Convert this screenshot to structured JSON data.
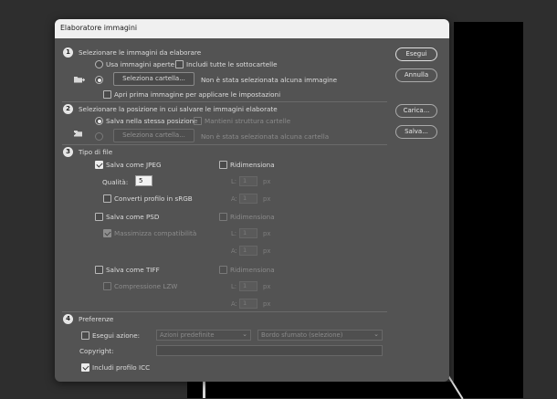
{
  "dialog": {
    "title": "Elaboratore immagini",
    "buttons": {
      "run": "Esegui",
      "cancel": "Annulla",
      "load": "Carica...",
      "save": "Salva..."
    }
  },
  "section1": {
    "step": "1",
    "title": "Selezionare le immagini da elaborare",
    "use_open": "Usa immagini aperte",
    "include_sub": "Includi tutte le sottocartelle",
    "select_folder": "Seleziona cartella...",
    "none_selected": "Non è stata selezionata alcuna immagine",
    "open_first": "Apri prima immagine per applicare le impostazioni"
  },
  "section2": {
    "step": "2",
    "title": "Selezionare la posizione in cui salvare le immagini elaborate",
    "same_location": "Salva nella stessa posizione",
    "keep_structure": "Mantieni struttura cartelle",
    "select_folder": "Seleziona cartella...",
    "none_selected": "Non è stata selezionata alcuna cartella"
  },
  "section3": {
    "step": "3",
    "title": "Tipo di file",
    "jpeg": "Salva come JPEG",
    "resize": "Ridimensiona",
    "quality_label": "Qualità:",
    "quality_value": "5",
    "convert_srgb": "Converti profilo in sRGB",
    "psd": "Salva come PSD",
    "maximize": "Massimizza compatibilità",
    "tiff": "Salva come TIFF",
    "lzw": "Compressione LZW",
    "w_label": "L:",
    "h_label": "A:",
    "unit": "px",
    "dim_value": "1"
  },
  "section4": {
    "step": "4",
    "title": "Preferenze",
    "run_action": "Esegui azione:",
    "action_set": "Azioni predefinite",
    "action_name": "Bordo sfumato (selezione)",
    "copyright": "Copyright:",
    "include_icc": "Includi profilo ICC"
  }
}
